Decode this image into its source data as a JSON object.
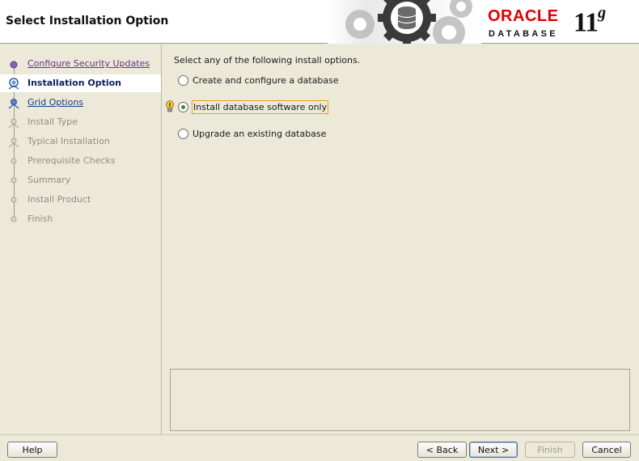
{
  "header": {
    "title": "Select Installation Option",
    "brand": {
      "name": "ORACLE",
      "product": "DATABASE",
      "version": "11",
      "version_suffix": "g",
      "accent": "#e00000"
    }
  },
  "sidebar": {
    "steps": [
      {
        "label": "Configure Security Updates",
        "state": "visited"
      },
      {
        "label": "Installation Option",
        "state": "current"
      },
      {
        "label": "Grid Options",
        "state": "link"
      },
      {
        "label": "Install Type",
        "state": "future"
      },
      {
        "label": "Typical Installation",
        "state": "future"
      },
      {
        "label": "Prerequisite Checks",
        "state": "future"
      },
      {
        "label": "Summary",
        "state": "future"
      },
      {
        "label": "Install Product",
        "state": "future"
      },
      {
        "label": "Finish",
        "state": "future"
      }
    ]
  },
  "main": {
    "prompt": "Select any of the following install options.",
    "options": [
      {
        "label": "Create and configure a database",
        "selected": false
      },
      {
        "label": "Install database software only",
        "selected": true
      },
      {
        "label": "Upgrade an existing database",
        "selected": false
      }
    ],
    "hint_icon": "lightbulb-icon"
  },
  "footer": {
    "help": "Help",
    "back": "< Back",
    "next": "Next >",
    "finish": "Finish",
    "cancel": "Cancel"
  }
}
